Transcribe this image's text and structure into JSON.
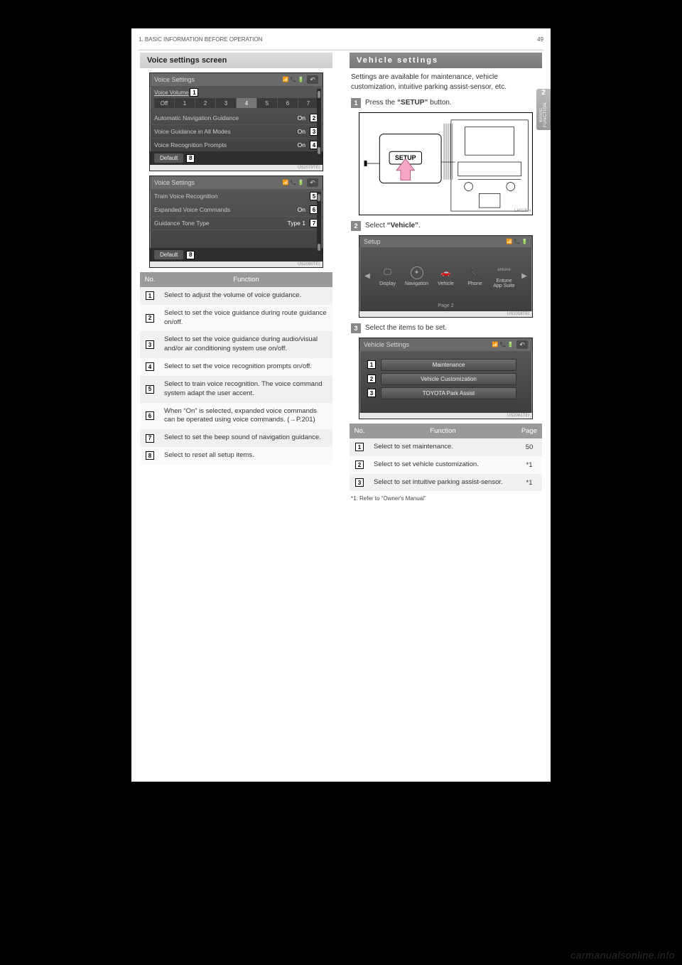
{
  "header": {
    "page_num": "49",
    "section": "1. BASIC INFORMATION BEFORE OPERATION"
  },
  "side_tab": {
    "num": "2",
    "label": "BASIC FUNCTION"
  },
  "left": {
    "subheading": "Voice settings screen",
    "screen1": {
      "title": "Voice Settings",
      "volume_label": "Voice Volume",
      "volume_cells": [
        "Off",
        "1",
        "2",
        "3",
        "4",
        "5",
        "6",
        "7"
      ],
      "volume_selected_index": 4,
      "rows": [
        {
          "label": "Automatic Navigation Guidance",
          "value": "On",
          "num": "2"
        },
        {
          "label": "Voice Guidance in All Modes",
          "value": "On",
          "num": "3"
        },
        {
          "label": "Voice Recognition Prompts",
          "value": "On",
          "num": "4"
        }
      ],
      "default_btn": "Default",
      "default_num": "8",
      "vol_num": "1",
      "image_id": "US2079TEI"
    },
    "screen2": {
      "title": "Voice Settings",
      "rows": [
        {
          "label": "Train Voice Recognition",
          "value": "",
          "num": "5"
        },
        {
          "label": "Expanded Voice Commands",
          "value": "On",
          "num": "6"
        },
        {
          "label": "Guidance Tone Type",
          "value": "Type 1",
          "num": "7"
        }
      ],
      "default_btn": "Default",
      "default_num": "8",
      "image_id": "US2080TEI"
    },
    "table": {
      "headers": [
        "No.",
        "Function"
      ],
      "rows": [
        {
          "n": "1",
          "desc": "Select to adjust the volume of voice guidance."
        },
        {
          "n": "2",
          "desc": "Select to set the voice guidance during route guidance on/off."
        },
        {
          "n": "3",
          "desc": "Select to set the voice guidance during audio/visual and/or air conditioning system use on/off."
        },
        {
          "n": "4",
          "desc": "Select to set the voice recognition prompts on/off."
        },
        {
          "n": "5",
          "desc": "Select to train voice recognition.\nThe voice command system adapt the user accent."
        },
        {
          "n": "6",
          "desc": "When “On” is selected, expanded voice commands can be operated using voice commands. (→P.201)"
        },
        {
          "n": "7",
          "desc": "Select to set the beep sound of navigation guidance."
        },
        {
          "n": "8",
          "desc": "Select to reset all setup items."
        }
      ]
    }
  },
  "right": {
    "subheading": "Vehicle settings",
    "intro": "Settings are available for maintenance, vehicle customization, intuitive parking assist-sensor, etc.",
    "step1": {
      "num": "1",
      "text_pre": "Press the ",
      "bold": "“SETUP”",
      "text_post": " button."
    },
    "dash": {
      "button_label": "SETUP",
      "image_id": "LA013IN"
    },
    "step2": {
      "num": "2",
      "text_pre": "Select ",
      "bold": "“Vehicle”",
      "text_post": "."
    },
    "setup_screen": {
      "title": "Setup",
      "items": [
        {
          "icon": "display",
          "label": "Display"
        },
        {
          "icon": "nav",
          "label": "Navigation"
        },
        {
          "icon": "vehicle",
          "label": "Vehicle"
        },
        {
          "icon": "phone",
          "label": "Phone"
        },
        {
          "icon": "entune",
          "label1": "Entune",
          "label2": "App Suite"
        }
      ],
      "page": "Page 2",
      "image_id": "US1018TEI"
    },
    "step3": {
      "num": "3",
      "text": "Select the items to be set."
    },
    "vset_screen": {
      "title": "Vehicle Settings",
      "items": [
        {
          "num": "1",
          "label": "Maintenance"
        },
        {
          "num": "2",
          "label": "Vehicle Customization"
        },
        {
          "num": "3",
          "label": "TOYOTA Park Assist"
        }
      ],
      "image_id": "US2081TEI"
    },
    "table": {
      "headers": [
        "No.",
        "Function",
        "Page"
      ],
      "rows": [
        {
          "n": "1",
          "desc": "Select to set maintenance.",
          "page": "50"
        },
        {
          "n": "2",
          "desc": "Select to set vehicle customization.",
          "page": "*1"
        },
        {
          "n": "3",
          "desc": "Select to set intuitive parking assist-sensor.",
          "page": "*1"
        }
      ]
    },
    "footnote": "*1: Refer to “Owner's Manual”"
  },
  "watermark": "carmanualsonline.info"
}
